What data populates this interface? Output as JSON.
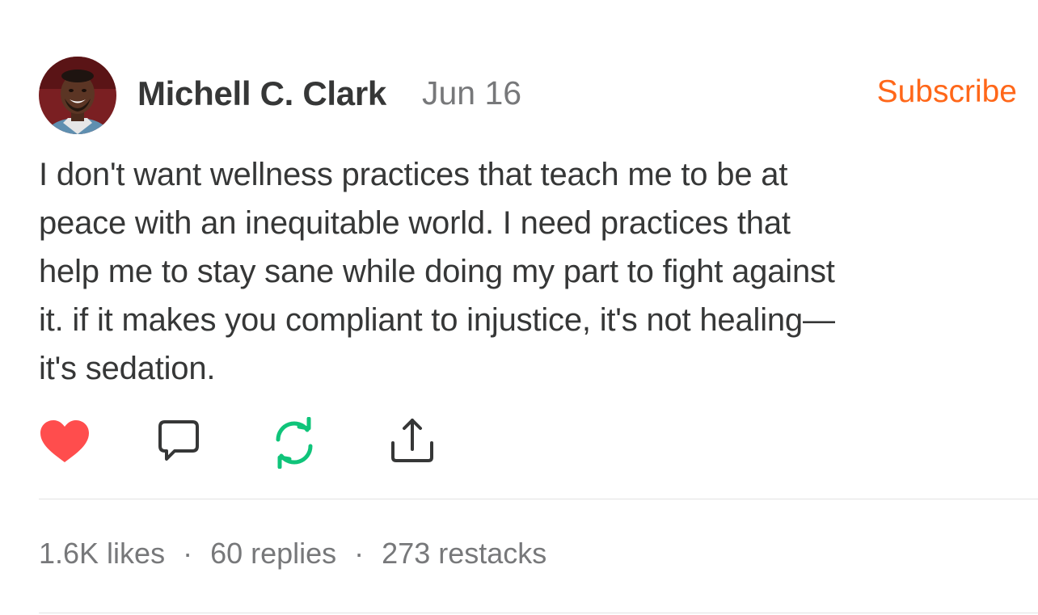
{
  "note": {
    "author": "Michell C. Clark",
    "date": "Jun 16",
    "subscribe_label": "Subscribe",
    "body": "I don't want wellness practices that teach me to be at\npeace with an inequitable world. I need practices that\nhelp me to stay sane while doing my part to fight against\nit. if it makes you compliant to injustice, it's not healing—\nit's sedation."
  },
  "actions": [
    {
      "icon": "heart-icon",
      "state": "liked",
      "color": "#ff4d4d"
    },
    {
      "icon": "comment-bubble-icon",
      "color": "#363737"
    },
    {
      "icon": "restack-icon",
      "state": "restacked",
      "color": "#0fc47a"
    },
    {
      "icon": "share-icon",
      "color": "#363737"
    }
  ],
  "stats": {
    "likes": "1.6K likes",
    "separator": "·",
    "replies": "60 replies",
    "restacks": "273 restacks"
  },
  "colors": {
    "accent": "#ff6719",
    "text": "#363737",
    "muted": "#77787a",
    "divider": "#e2e2e3"
  }
}
